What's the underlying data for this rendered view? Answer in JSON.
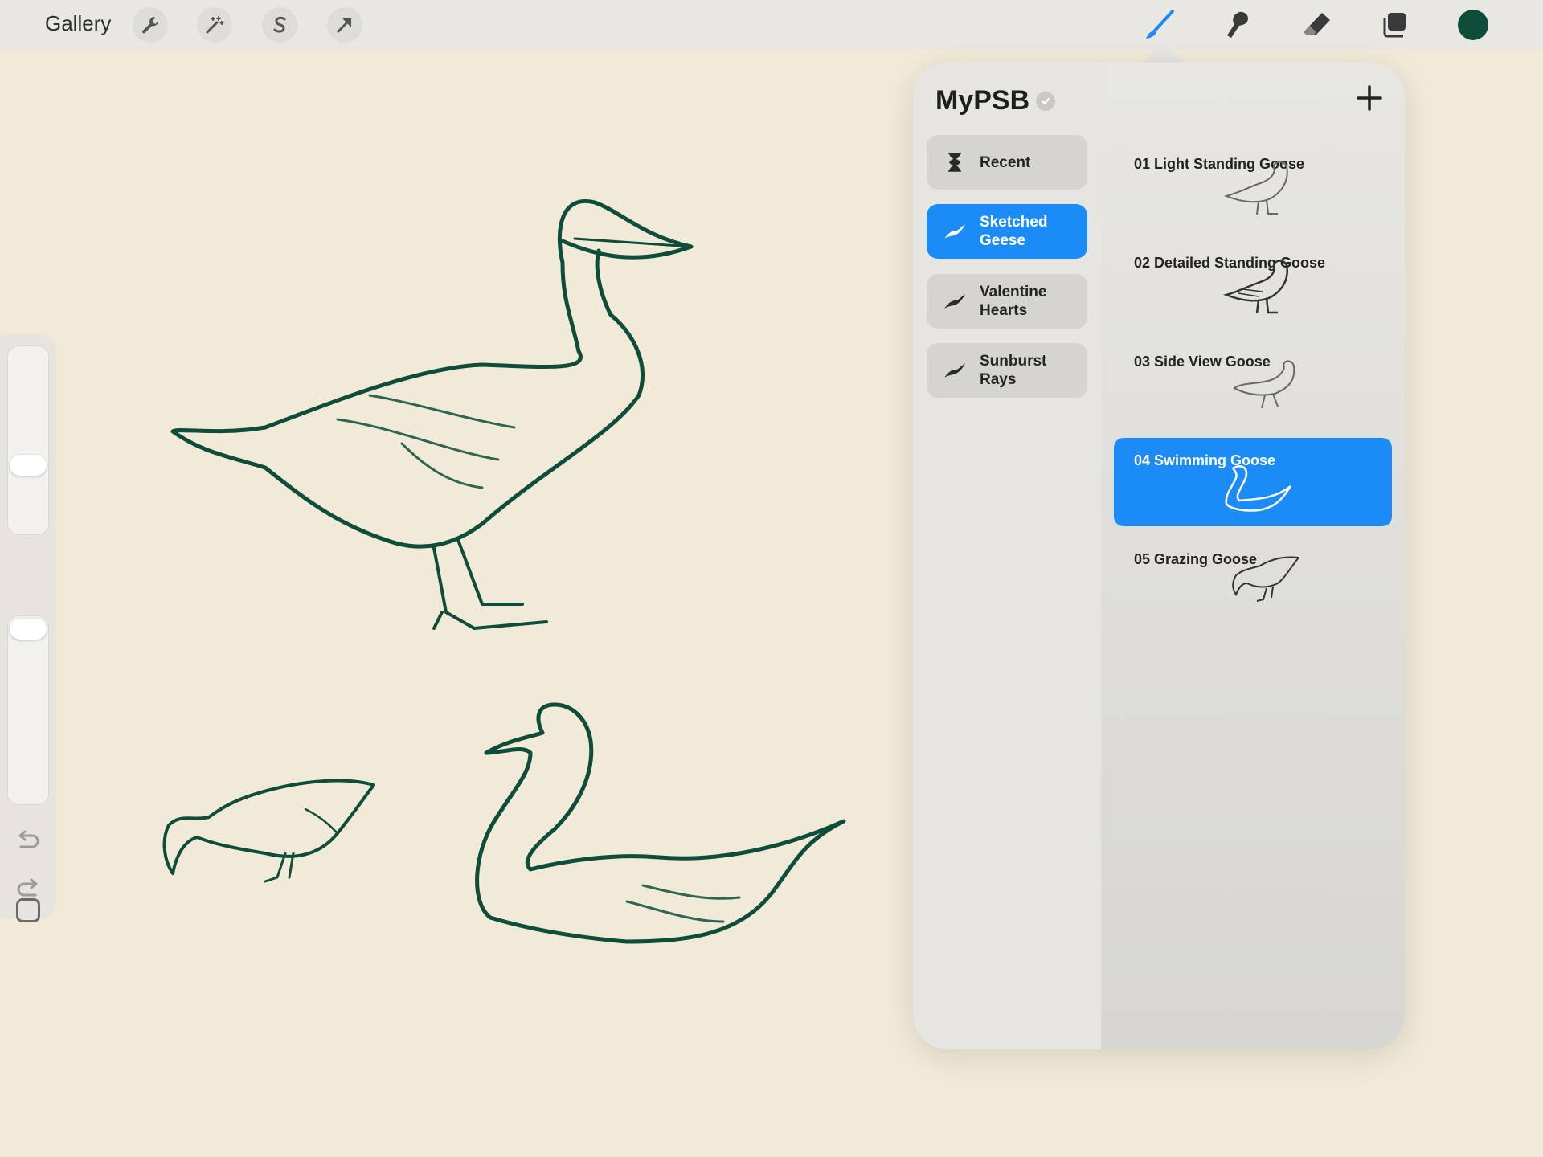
{
  "topbar": {
    "gallery_label": "Gallery",
    "tools": [
      {
        "name": "wrench-icon"
      },
      {
        "name": "magic-wand-icon"
      },
      {
        "name": "selection-s-icon"
      },
      {
        "name": "transform-arrow-icon"
      }
    ],
    "right_tools": [
      "brush-icon",
      "smudge-icon",
      "eraser-icon",
      "layers-icon"
    ],
    "current_color": "#0d4d3a",
    "active_tool_color": "#1b8cf5"
  },
  "brush_library": {
    "title": "MyPSB",
    "sets": [
      {
        "label": "Recent",
        "icon": "hourglass-icon",
        "active": false
      },
      {
        "label": "Sketched Geese",
        "icon": "brush-stroke-icon",
        "active": true
      },
      {
        "label": "Valentine Hearts",
        "icon": "brush-stroke-icon",
        "active": false
      },
      {
        "label": "Sunburst Rays",
        "icon": "brush-stroke-icon",
        "active": false
      }
    ],
    "brushes": [
      {
        "label": "01 Light Standing Goose",
        "active": false
      },
      {
        "label": "02 Detailed Standing Goose",
        "active": false
      },
      {
        "label": "03 Side View Goose",
        "active": false
      },
      {
        "label": "04 Swimming Goose",
        "active": true
      },
      {
        "label": "05 Grazing Goose",
        "active": false
      }
    ]
  },
  "canvas": {
    "background": "#f1ead8",
    "ink_color": "#0d4d3a"
  },
  "sidebar": {
    "brush_size_level": 0.64,
    "opacity_level": 0.93
  }
}
